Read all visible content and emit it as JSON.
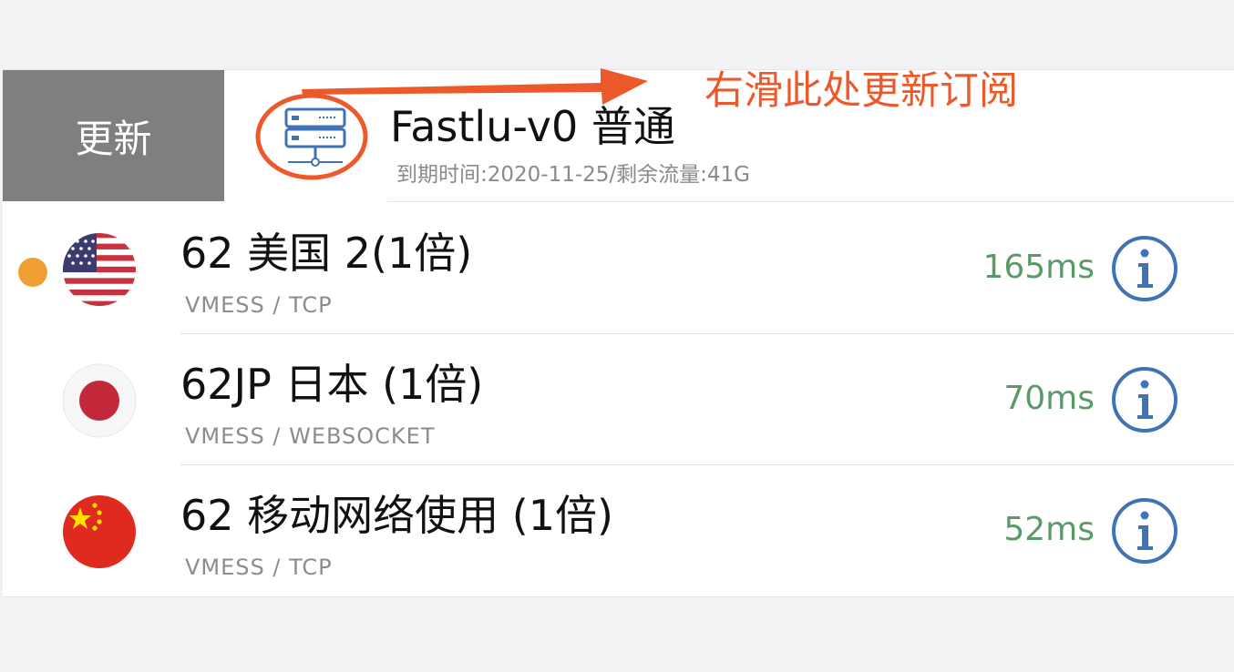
{
  "subscription": {
    "swipe_action_label": "更新",
    "icon": "server-stack-icon",
    "name": "Fastlu-v0 普通",
    "meta": "到期时间:2020-11-25/剩余流量:41G"
  },
  "annotation": {
    "text": "右滑此处更新订阅",
    "color": "#ec5a2b"
  },
  "servers": [
    {
      "flag": "us-flag-icon",
      "name": "62 美国 2(1倍)",
      "protocol": "VMESS / TCP",
      "latency": "165ms",
      "selected": true,
      "status_color": "#f0a033"
    },
    {
      "flag": "jp-flag-icon",
      "name": "62JP 日本 (1倍)",
      "protocol": "VMESS / WEBSOCKET",
      "latency": "70ms",
      "selected": false
    },
    {
      "flag": "cn-flag-icon",
      "name": "62 移动网络使用 (1倍)",
      "protocol": "VMESS / TCP",
      "latency": "52ms",
      "selected": false
    }
  ],
  "colors": {
    "latency": "#5a9a68",
    "info_icon": "#3f73b6",
    "swipe_action_bg": "#7f7f7f",
    "subscription_icon": "#3f73b6"
  }
}
